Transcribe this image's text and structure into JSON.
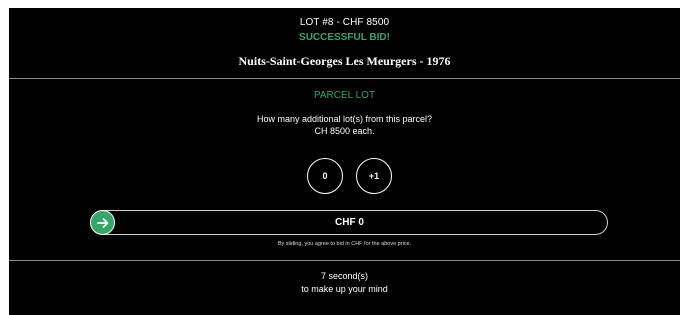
{
  "header": {
    "lot_line": "LOT #8 - CHF 8500",
    "status": "SUCCESSFUL BID!",
    "wine_name": "Nuits-Saint-Georges Les Meurgers - 1976"
  },
  "parcel": {
    "title": "PARCEL LOT",
    "question": "How many additional lot(s) from this parcel?",
    "price_each": "CH 8500 each.",
    "options": [
      "0",
      "+1"
    ]
  },
  "slider": {
    "value_label": "CHF 0",
    "agree_text": "By sliding, you agree to bid in CHF for the above price."
  },
  "timer": {
    "seconds_text": "7 second(s)",
    "subtext": "to make up your mind"
  },
  "colors": {
    "background": "#000000",
    "accent_green": "#3aa56a",
    "text": "#ffffff"
  }
}
